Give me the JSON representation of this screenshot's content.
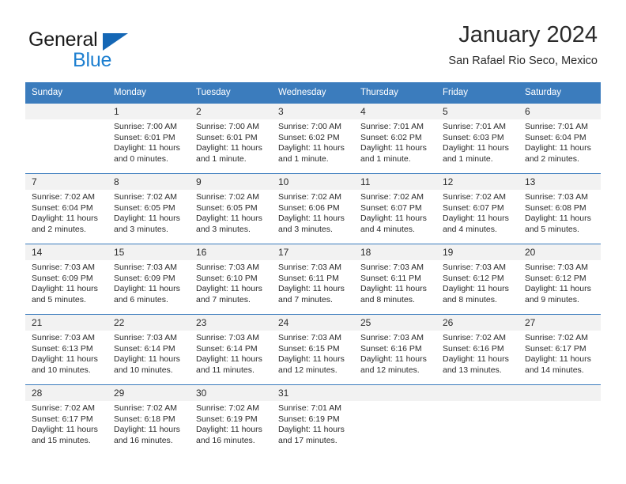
{
  "logo": {
    "word1": "General",
    "word2": "Blue",
    "triangle_color": "#1567b5",
    "word2_color": "#1d7fd0"
  },
  "header": {
    "title": "January 2024",
    "subtitle": "San Rafael Rio Seco, Mexico"
  },
  "theme": {
    "header_blue": "#3b7cbd",
    "day_band_gray": "#f2f2f2",
    "text": "#2b2b2b"
  },
  "weekdays": [
    "Sunday",
    "Monday",
    "Tuesday",
    "Wednesday",
    "Thursday",
    "Friday",
    "Saturday"
  ],
  "weeks": [
    [
      {
        "day": "",
        "sunrise": "",
        "sunset": "",
        "daylight1": "",
        "daylight2": ""
      },
      {
        "day": "1",
        "sunrise": "Sunrise: 7:00 AM",
        "sunset": "Sunset: 6:01 PM",
        "daylight1": "Daylight: 11 hours",
        "daylight2": "and 0 minutes."
      },
      {
        "day": "2",
        "sunrise": "Sunrise: 7:00 AM",
        "sunset": "Sunset: 6:01 PM",
        "daylight1": "Daylight: 11 hours",
        "daylight2": "and 1 minute."
      },
      {
        "day": "3",
        "sunrise": "Sunrise: 7:00 AM",
        "sunset": "Sunset: 6:02 PM",
        "daylight1": "Daylight: 11 hours",
        "daylight2": "and 1 minute."
      },
      {
        "day": "4",
        "sunrise": "Sunrise: 7:01 AM",
        "sunset": "Sunset: 6:02 PM",
        "daylight1": "Daylight: 11 hours",
        "daylight2": "and 1 minute."
      },
      {
        "day": "5",
        "sunrise": "Sunrise: 7:01 AM",
        "sunset": "Sunset: 6:03 PM",
        "daylight1": "Daylight: 11 hours",
        "daylight2": "and 1 minute."
      },
      {
        "day": "6",
        "sunrise": "Sunrise: 7:01 AM",
        "sunset": "Sunset: 6:04 PM",
        "daylight1": "Daylight: 11 hours",
        "daylight2": "and 2 minutes."
      }
    ],
    [
      {
        "day": "7",
        "sunrise": "Sunrise: 7:02 AM",
        "sunset": "Sunset: 6:04 PM",
        "daylight1": "Daylight: 11 hours",
        "daylight2": "and 2 minutes."
      },
      {
        "day": "8",
        "sunrise": "Sunrise: 7:02 AM",
        "sunset": "Sunset: 6:05 PM",
        "daylight1": "Daylight: 11 hours",
        "daylight2": "and 3 minutes."
      },
      {
        "day": "9",
        "sunrise": "Sunrise: 7:02 AM",
        "sunset": "Sunset: 6:05 PM",
        "daylight1": "Daylight: 11 hours",
        "daylight2": "and 3 minutes."
      },
      {
        "day": "10",
        "sunrise": "Sunrise: 7:02 AM",
        "sunset": "Sunset: 6:06 PM",
        "daylight1": "Daylight: 11 hours",
        "daylight2": "and 3 minutes."
      },
      {
        "day": "11",
        "sunrise": "Sunrise: 7:02 AM",
        "sunset": "Sunset: 6:07 PM",
        "daylight1": "Daylight: 11 hours",
        "daylight2": "and 4 minutes."
      },
      {
        "day": "12",
        "sunrise": "Sunrise: 7:02 AM",
        "sunset": "Sunset: 6:07 PM",
        "daylight1": "Daylight: 11 hours",
        "daylight2": "and 4 minutes."
      },
      {
        "day": "13",
        "sunrise": "Sunrise: 7:03 AM",
        "sunset": "Sunset: 6:08 PM",
        "daylight1": "Daylight: 11 hours",
        "daylight2": "and 5 minutes."
      }
    ],
    [
      {
        "day": "14",
        "sunrise": "Sunrise: 7:03 AM",
        "sunset": "Sunset: 6:09 PM",
        "daylight1": "Daylight: 11 hours",
        "daylight2": "and 5 minutes."
      },
      {
        "day": "15",
        "sunrise": "Sunrise: 7:03 AM",
        "sunset": "Sunset: 6:09 PM",
        "daylight1": "Daylight: 11 hours",
        "daylight2": "and 6 minutes."
      },
      {
        "day": "16",
        "sunrise": "Sunrise: 7:03 AM",
        "sunset": "Sunset: 6:10 PM",
        "daylight1": "Daylight: 11 hours",
        "daylight2": "and 7 minutes."
      },
      {
        "day": "17",
        "sunrise": "Sunrise: 7:03 AM",
        "sunset": "Sunset: 6:11 PM",
        "daylight1": "Daylight: 11 hours",
        "daylight2": "and 7 minutes."
      },
      {
        "day": "18",
        "sunrise": "Sunrise: 7:03 AM",
        "sunset": "Sunset: 6:11 PM",
        "daylight1": "Daylight: 11 hours",
        "daylight2": "and 8 minutes."
      },
      {
        "day": "19",
        "sunrise": "Sunrise: 7:03 AM",
        "sunset": "Sunset: 6:12 PM",
        "daylight1": "Daylight: 11 hours",
        "daylight2": "and 8 minutes."
      },
      {
        "day": "20",
        "sunrise": "Sunrise: 7:03 AM",
        "sunset": "Sunset: 6:12 PM",
        "daylight1": "Daylight: 11 hours",
        "daylight2": "and 9 minutes."
      }
    ],
    [
      {
        "day": "21",
        "sunrise": "Sunrise: 7:03 AM",
        "sunset": "Sunset: 6:13 PM",
        "daylight1": "Daylight: 11 hours",
        "daylight2": "and 10 minutes."
      },
      {
        "day": "22",
        "sunrise": "Sunrise: 7:03 AM",
        "sunset": "Sunset: 6:14 PM",
        "daylight1": "Daylight: 11 hours",
        "daylight2": "and 10 minutes."
      },
      {
        "day": "23",
        "sunrise": "Sunrise: 7:03 AM",
        "sunset": "Sunset: 6:14 PM",
        "daylight1": "Daylight: 11 hours",
        "daylight2": "and 11 minutes."
      },
      {
        "day": "24",
        "sunrise": "Sunrise: 7:03 AM",
        "sunset": "Sunset: 6:15 PM",
        "daylight1": "Daylight: 11 hours",
        "daylight2": "and 12 minutes."
      },
      {
        "day": "25",
        "sunrise": "Sunrise: 7:03 AM",
        "sunset": "Sunset: 6:16 PM",
        "daylight1": "Daylight: 11 hours",
        "daylight2": "and 12 minutes."
      },
      {
        "day": "26",
        "sunrise": "Sunrise: 7:02 AM",
        "sunset": "Sunset: 6:16 PM",
        "daylight1": "Daylight: 11 hours",
        "daylight2": "and 13 minutes."
      },
      {
        "day": "27",
        "sunrise": "Sunrise: 7:02 AM",
        "sunset": "Sunset: 6:17 PM",
        "daylight1": "Daylight: 11 hours",
        "daylight2": "and 14 minutes."
      }
    ],
    [
      {
        "day": "28",
        "sunrise": "Sunrise: 7:02 AM",
        "sunset": "Sunset: 6:17 PM",
        "daylight1": "Daylight: 11 hours",
        "daylight2": "and 15 minutes."
      },
      {
        "day": "29",
        "sunrise": "Sunrise: 7:02 AM",
        "sunset": "Sunset: 6:18 PM",
        "daylight1": "Daylight: 11 hours",
        "daylight2": "and 16 minutes."
      },
      {
        "day": "30",
        "sunrise": "Sunrise: 7:02 AM",
        "sunset": "Sunset: 6:19 PM",
        "daylight1": "Daylight: 11 hours",
        "daylight2": "and 16 minutes."
      },
      {
        "day": "31",
        "sunrise": "Sunrise: 7:01 AM",
        "sunset": "Sunset: 6:19 PM",
        "daylight1": "Daylight: 11 hours",
        "daylight2": "and 17 minutes."
      },
      {
        "day": "",
        "sunrise": "",
        "sunset": "",
        "daylight1": "",
        "daylight2": ""
      },
      {
        "day": "",
        "sunrise": "",
        "sunset": "",
        "daylight1": "",
        "daylight2": ""
      },
      {
        "day": "",
        "sunrise": "",
        "sunset": "",
        "daylight1": "",
        "daylight2": ""
      }
    ]
  ]
}
